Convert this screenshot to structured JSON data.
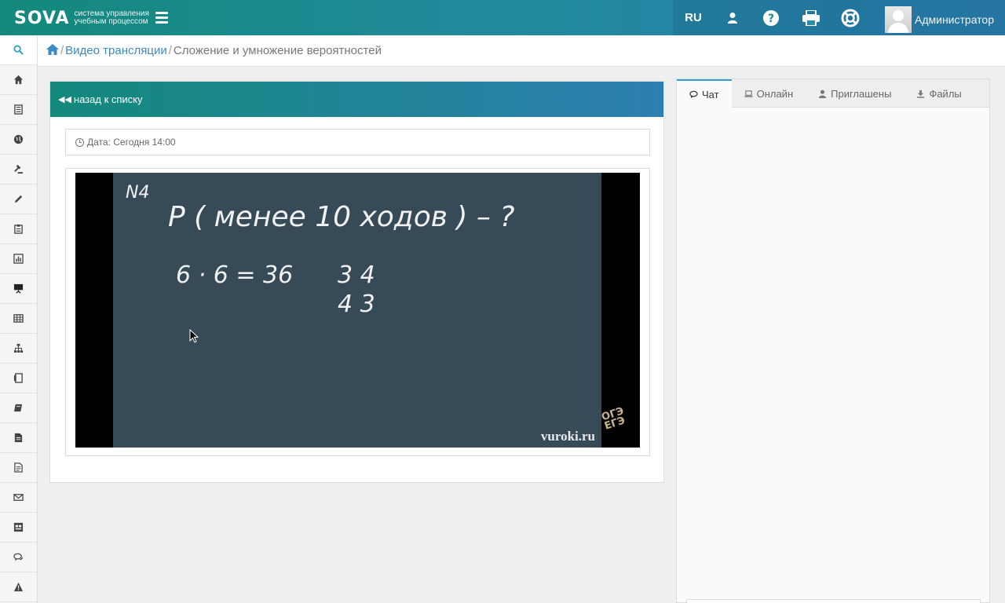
{
  "app": {
    "logo_text": "SOVA",
    "logo_subtitle": "система управления учебным процессом"
  },
  "topbar": {
    "lang": "RU",
    "icons": [
      "user-icon",
      "question-icon",
      "print-icon",
      "lifebuoy-icon"
    ],
    "user_name": "Администратор"
  },
  "sidebar": {
    "icons": [
      "search-icon",
      "home-icon",
      "list-icon",
      "globe-icon",
      "gavel-icon",
      "pencil-icon",
      "clipboard-icon",
      "bar-chart-icon",
      "presentation-icon",
      "table-icon",
      "sitemap-icon",
      "door-icon",
      "book-icon",
      "file-icon",
      "file-text-icon",
      "envelope-icon",
      "calendar-table-icon",
      "comments-icon",
      "warning-icon"
    ]
  },
  "breadcrumb": {
    "link": "Видео трансляции",
    "current": "Сложение и умножение вероятностей"
  },
  "panel": {
    "back_label": "назад к списку",
    "date_label": "Дата: Сегодня 14:00"
  },
  "video": {
    "board_lines": [
      "N4",
      "P ( менее   10 ходов ) – ?",
      "6 · 6 = 36",
      "3 4",
      "4 3"
    ],
    "watermark": "vuroki.ru",
    "badge_line1": "ОГЭ",
    "badge_line2": "ЕГЭ"
  },
  "chat": {
    "tabs": [
      {
        "label": "Чат",
        "icon": "comment-icon",
        "active": true
      },
      {
        "label": "Онлайн",
        "icon": "laptop-icon",
        "active": false
      },
      {
        "label": "Приглашены",
        "icon": "user-icon",
        "active": false
      },
      {
        "label": "Файлы",
        "icon": "download-icon",
        "active": false
      }
    ]
  },
  "colors": {
    "header_start": "#13897b",
    "header_end": "#2c7fb0",
    "link": "#3b8ac4",
    "board": "#364a58"
  }
}
